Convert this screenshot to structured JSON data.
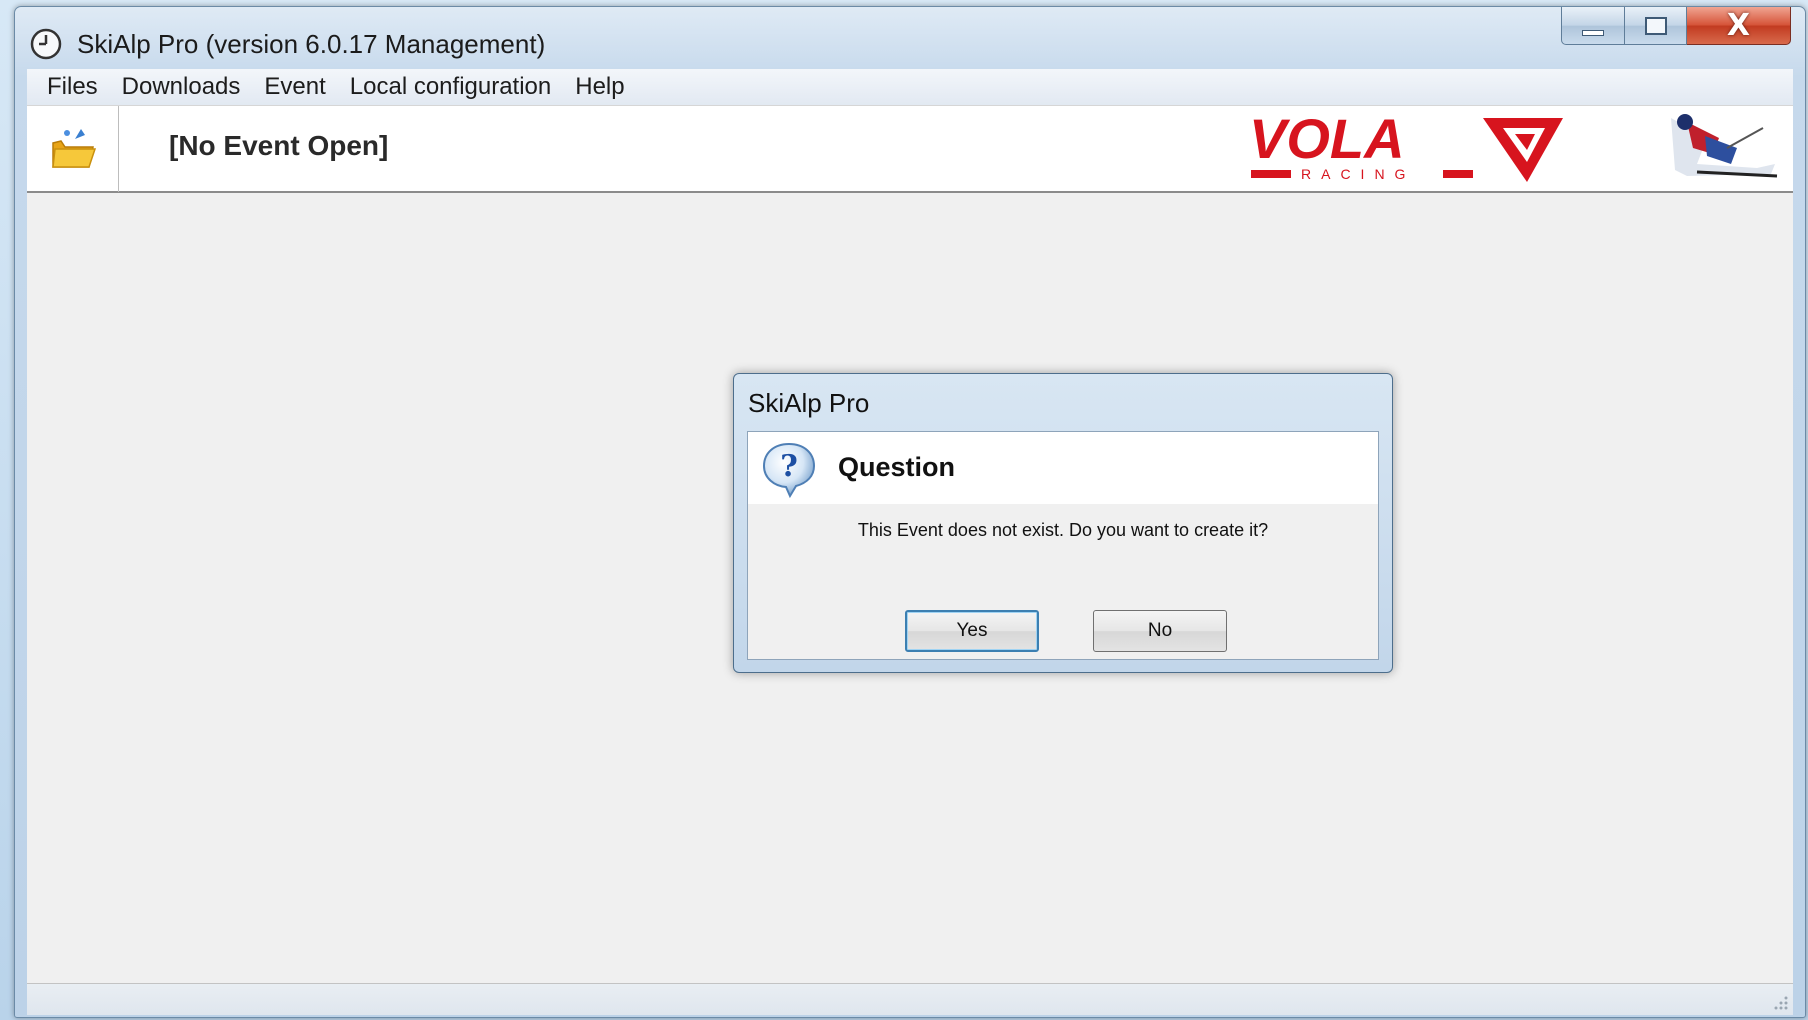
{
  "window": {
    "title": "SkiAlp Pro (version 6.0.17 Management)",
    "icon": "clock-icon",
    "controls": [
      "minimize-icon",
      "maximize-icon",
      "close-icon"
    ],
    "close_glyph": "X"
  },
  "menu": {
    "items": [
      {
        "label": "Files"
      },
      {
        "label": "Downloads"
      },
      {
        "label": "Event"
      },
      {
        "label": "Local configuration"
      },
      {
        "label": "Help"
      }
    ]
  },
  "toolbar": {
    "open_icon": "open-folder-icon",
    "event_status": "[No Event Open]",
    "brand_logo_text": "VOLA",
    "brand_logo_subtext": "RACING",
    "brand_color": "#d7141e"
  },
  "dialog": {
    "title": "SkiAlp Pro",
    "icon": "question-icon",
    "heading": "Question",
    "message": "This Event does not exist. Do you want to create it?",
    "yes_label": "Yes",
    "no_label": "No",
    "default_button": "Yes"
  }
}
